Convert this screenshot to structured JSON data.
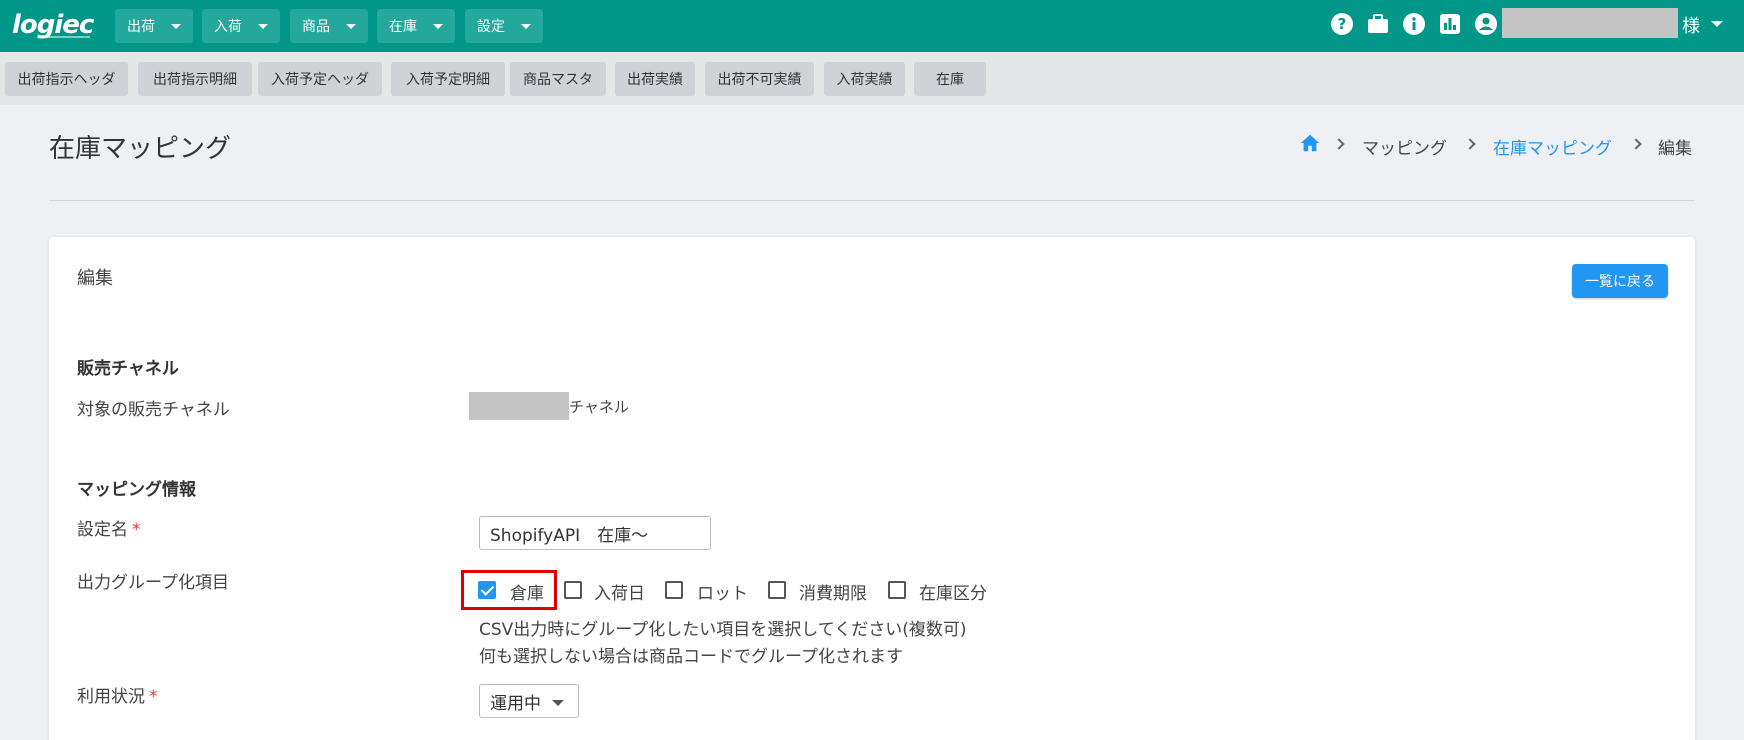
{
  "header": {
    "logo": "logiec",
    "nav": [
      {
        "label": "出荷"
      },
      {
        "label": "入荷"
      },
      {
        "label": "商品"
      },
      {
        "label": "在庫"
      },
      {
        "label": "設定"
      }
    ],
    "user_suffix": "様",
    "icons": [
      "help-icon",
      "briefcase-icon",
      "info-icon",
      "chart-icon",
      "account-icon"
    ]
  },
  "subnav": [
    "出荷指示ヘッダ",
    "出荷指示明細",
    "入荷予定ヘッダ",
    "入荷予定明細",
    "商品マスタ",
    "出荷実績",
    "出荷不可実績",
    "入荷実績",
    "在庫"
  ],
  "page": {
    "title": "在庫マッピング",
    "breadcrumb": [
      "マッピング",
      "在庫マッピング",
      "編集"
    ]
  },
  "card": {
    "title": "編集",
    "back_button": "一覧に戻る",
    "sales_channel": {
      "heading": "販売チャネル",
      "label": "対象の販売チャネル",
      "suffix": "チャネル"
    },
    "mapping": {
      "heading": "マッピング情報",
      "setting_name_label": "設定名",
      "setting_name_value": "ShopifyAPI　在庫～",
      "group_label": "出力グループ化項目",
      "group_options": [
        {
          "label": "倉庫",
          "checked": true
        },
        {
          "label": "入荷日",
          "checked": false
        },
        {
          "label": "ロット",
          "checked": false
        },
        {
          "label": "消費期限",
          "checked": false
        },
        {
          "label": "在庫区分",
          "checked": false
        }
      ],
      "hint1": "CSV出力時にグループ化したい項目を選択してください(複数可)",
      "hint2": "何も選択しない場合は商品コードでグループ化されます",
      "status_label": "利用状況",
      "status_value": "運用中",
      "required_mark": "*"
    }
  },
  "colors": {
    "primary": "#009688",
    "accent": "#2196f3",
    "highlight": "#e00000"
  }
}
